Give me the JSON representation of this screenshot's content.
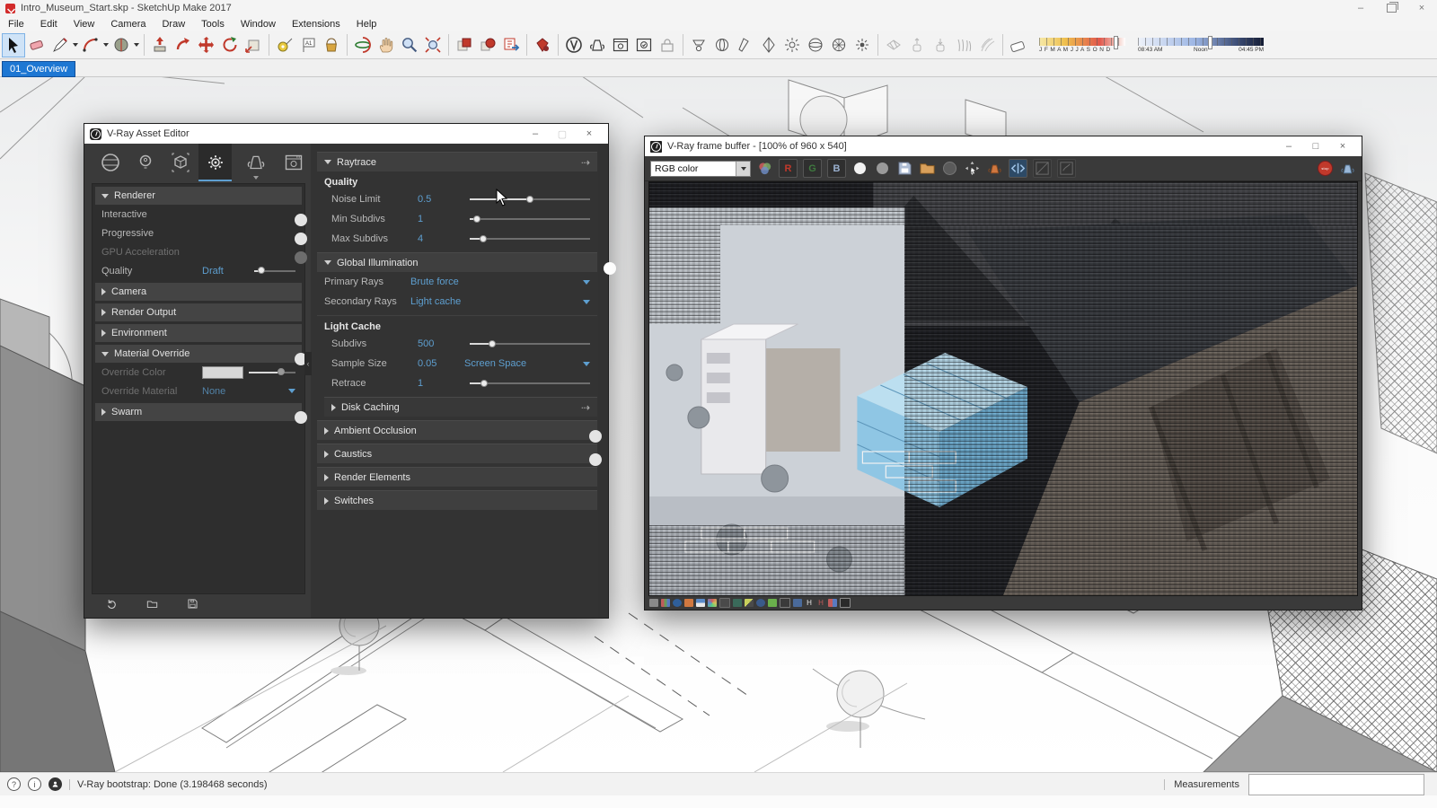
{
  "titlebar": {
    "title": "Intro_Museum_Start.skp - SketchUp Make 2017",
    "minimize_glyph": "–",
    "close_glyph": "×"
  },
  "menu_bar": [
    "File",
    "Edit",
    "View",
    "Camera",
    "Draw",
    "Tools",
    "Window",
    "Extensions",
    "Help"
  ],
  "shadow_toolbar": {
    "months": "J F M A M J J A S O N D",
    "time_start": "08:43 AM",
    "time_noon": "Noon",
    "time_end": "04:45 PM"
  },
  "scene_tab": "01_Overview",
  "asset_editor": {
    "title": "V-Ray Asset Editor",
    "minimize_glyph": "–",
    "close_glyph": "×",
    "left": {
      "renderer": "Renderer",
      "interactive": "Interactive",
      "progressive": "Progressive",
      "gpu_acceleration": "GPU Acceleration",
      "quality": "Quality",
      "quality_value": "Draft",
      "camera": "Camera",
      "render_output": "Render Output",
      "environment": "Environment",
      "material_override": "Material Override",
      "override_color": "Override Color",
      "override_material": "Override Material",
      "override_material_value": "None",
      "swarm": "Swarm"
    },
    "right": {
      "raytrace": "Raytrace",
      "quality_group": "Quality",
      "noise_limit": "Noise Limit",
      "noise_limit_value": "0.5",
      "min_subdivs": "Min Subdivs",
      "min_subdivs_value": "1",
      "max_subdivs": "Max Subdivs",
      "max_subdivs_value": "4",
      "global_illumination": "Global Illumination",
      "primary_rays": "Primary Rays",
      "primary_rays_value": "Brute force",
      "secondary_rays": "Secondary Rays",
      "secondary_rays_value": "Light cache",
      "light_cache": "Light Cache",
      "subdivs": "Subdivs",
      "subdivs_value": "500",
      "sample_size": "Sample Size",
      "sample_size_value": "0.05",
      "sample_size_mode": "Screen Space",
      "retrace": "Retrace",
      "retrace_value": "1",
      "disk_caching": "Disk Caching",
      "ambient_occlusion": "Ambient Occlusion",
      "caustics": "Caustics",
      "render_elements": "Render Elements",
      "switches": "Switches"
    }
  },
  "frame_buffer": {
    "title": "V-Ray frame buffer - [100% of 960 x 540]",
    "minimize_glyph": "–",
    "maximize_glyph": "□",
    "close_glyph": "×",
    "channel_select": "RGB color",
    "red_button": "R",
    "green_button": "G",
    "blue_button": "B",
    "stop_label": "stop"
  },
  "status_bar": {
    "message": "V-Ray bootstrap: Done (3.198468 seconds)",
    "measurements_label": "Measurements",
    "help_glyph": "?",
    "info_glyph": "i"
  },
  "colors": {
    "accent_blue": "#2f6fb0",
    "value_blue": "#5e9fd0",
    "tab_blue": "#1d77d3"
  }
}
